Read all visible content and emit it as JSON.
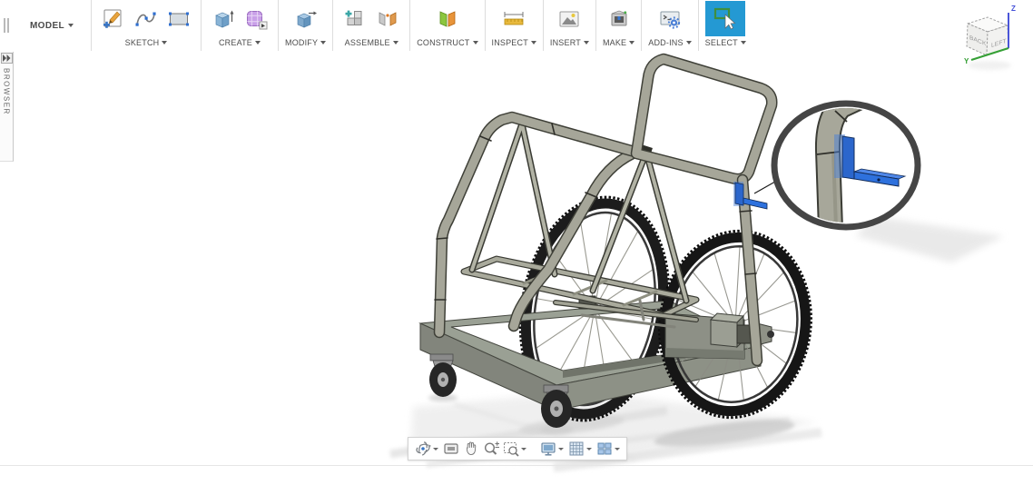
{
  "toolbar": {
    "workspace": {
      "label": "MODEL"
    },
    "groups": [
      {
        "label": "SKETCH",
        "tools": [
          "create-sketch",
          "fit-point-spline",
          "two-point-rectangle"
        ]
      },
      {
        "label": "CREATE",
        "tools": [
          "extrude",
          "create-form"
        ]
      },
      {
        "label": "MODIFY",
        "tools": [
          "press-pull"
        ]
      },
      {
        "label": "ASSEMBLE",
        "tools": [
          "new-component",
          "joint"
        ]
      },
      {
        "label": "CONSTRUCT",
        "tools": [
          "construction-plane"
        ]
      },
      {
        "label": "INSPECT",
        "tools": [
          "measure"
        ]
      },
      {
        "label": "INSERT",
        "tools": [
          "insert-image"
        ]
      },
      {
        "label": "MAKE",
        "tools": [
          "3d-print"
        ]
      },
      {
        "label": "ADD-INS",
        "tools": [
          "scripts-and-add-ins"
        ]
      },
      {
        "label": "SELECT",
        "tools": [
          "select"
        ]
      }
    ]
  },
  "browser": {
    "label": "BROWSER"
  },
  "viewcube": {
    "face_back": "BACK",
    "face_left": "LEFT",
    "axis_y": "Y",
    "axis_z": "Z"
  },
  "navbar": {
    "tools": [
      "orbit",
      "look-at",
      "pan",
      "zoom",
      "fit",
      "display-settings",
      "grid-and-snaps",
      "viewports"
    ]
  },
  "colors": {
    "select_highlight": "#2499d3",
    "bracket_blue": "#2e6fd6",
    "steel_tube": "#a6a699",
    "base_gray": "#9aa094",
    "tire_black": "#1a1a1a",
    "axis_z_blue": "#4a55d8",
    "axis_y_green": "#35a035"
  }
}
